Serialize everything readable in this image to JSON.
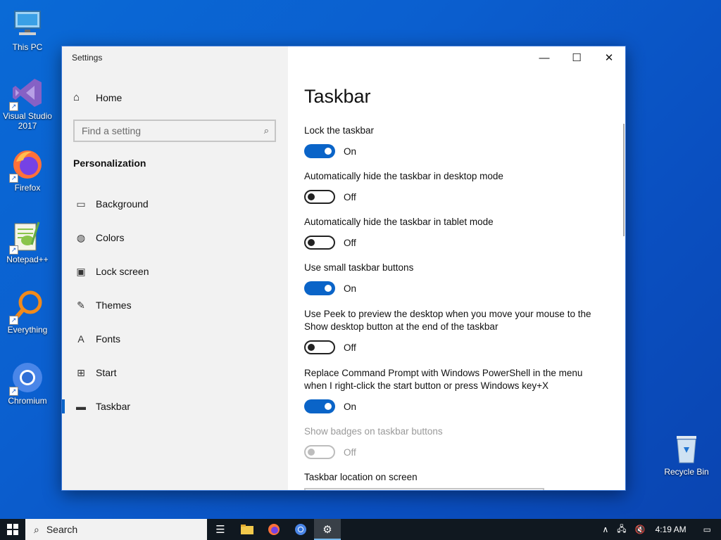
{
  "desktop": {
    "icons": [
      {
        "label": "This PC"
      },
      {
        "label": "Visual Studio 2017"
      },
      {
        "label": "Firefox"
      },
      {
        "label": "Notepad++"
      },
      {
        "label": "Everything"
      },
      {
        "label": "Chromium"
      },
      {
        "label": "Recycle Bin"
      }
    ]
  },
  "window": {
    "title": "Settings",
    "controls": {
      "minimize": "—",
      "maximize": "☐",
      "close": "✕"
    }
  },
  "nav": {
    "home_label": "Home",
    "search_placeholder": "Find a setting",
    "section": "Personalization",
    "items": [
      {
        "label": "Background",
        "icon": "image-icon"
      },
      {
        "label": "Colors",
        "icon": "palette-icon"
      },
      {
        "label": "Lock screen",
        "icon": "lock-screen-icon"
      },
      {
        "label": "Themes",
        "icon": "themes-icon"
      },
      {
        "label": "Fonts",
        "icon": "fonts-icon"
      },
      {
        "label": "Start",
        "icon": "start-icon"
      },
      {
        "label": "Taskbar",
        "icon": "taskbar-icon",
        "active": true
      }
    ]
  },
  "content": {
    "title": "Taskbar",
    "settings": [
      {
        "label": "Lock the taskbar",
        "state": "On"
      },
      {
        "label": "Automatically hide the taskbar in desktop mode",
        "state": "Off"
      },
      {
        "label": "Automatically hide the taskbar in tablet mode",
        "state": "Off"
      },
      {
        "label": "Use small taskbar buttons",
        "state": "On"
      },
      {
        "label_line1": "Use Peek to preview the desktop when you move your mouse to the",
        "label_line2": "Show desktop button at the end of the taskbar",
        "state": "Off"
      },
      {
        "label_line1": "Replace Command Prompt with Windows PowerShell in the menu",
        "label_line2": "when I right-click the start button or press Windows key+X",
        "state": "On"
      },
      {
        "label": "Show badges on taskbar buttons",
        "state": "Off",
        "disabled": true
      }
    ],
    "location_label": "Taskbar location on screen"
  },
  "taskbar": {
    "search_label": "Search",
    "clock": "4:19 AM"
  },
  "colors": {
    "accent": "#0a64c8",
    "taskbar": "#101820"
  }
}
